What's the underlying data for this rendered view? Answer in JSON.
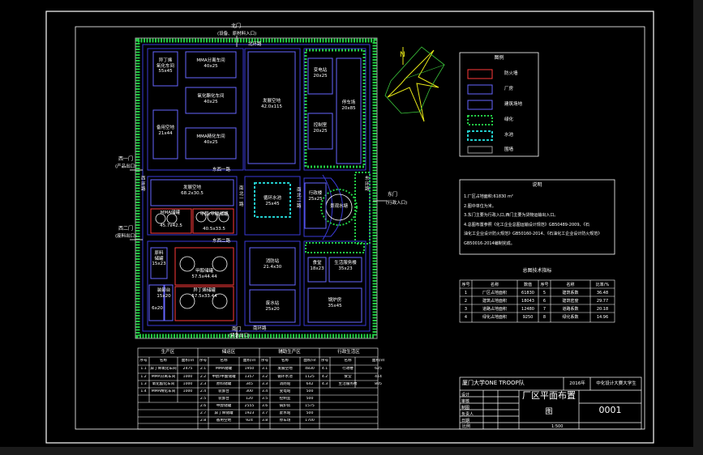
{
  "colors": {
    "background": "#000000",
    "frame": "#ffffff",
    "road": "#3a3ad8",
    "building": "#6666ff",
    "firewall": "#ff3a3a",
    "green": "#22cc44",
    "water": "#22cccc",
    "wall": "#9a9a9a",
    "compass": "#e6e617",
    "compass_web": "#3cc83c"
  },
  "gates": {
    "north": "北门",
    "north_sub": "(设备、原材料入口)",
    "west_gate1": "西一门",
    "west_gate1_sub": "(产品出口)",
    "west_gate2": "西二门",
    "west_gate2_sub": "(废料出口)",
    "east": "东门",
    "east_sub": "(行政入口)",
    "south": "南门",
    "south_sub": "(紧急出口)"
  },
  "roads": {
    "north": "北环路",
    "east1": "东环路",
    "south": "南环路",
    "west1": "西环路",
    "east_row1": "东西一路",
    "east_row2": "东西二路",
    "ns1": "南北一路",
    "ns2": "南北二路"
  },
  "buildings": {
    "b1": [
      "异丁烯",
      "氧化车间",
      "55x45"
    ],
    "b2": [
      "MMA分离车间",
      "40x25"
    ],
    "b3": [
      "氧化酯化车间",
      "40x25"
    ],
    "b4": [
      "MMA精化车间",
      "40x25"
    ],
    "b5": [
      "备用空地",
      "21x44"
    ],
    "b6": [
      "发展空地",
      "42.0x115"
    ],
    "b7": [
      "变电站",
      "20x25"
    ],
    "b8": [
      "停车场",
      "20x85"
    ],
    "b9": [
      "控制室",
      "20x25"
    ],
    "b10": [
      "发展空地",
      "68.2x30.5"
    ],
    "b11": [
      "MMA储罐",
      "45.7x42.5"
    ],
    "b12": [
      "甲醇/甲酸储罐",
      "40.5x33.5"
    ],
    "b13": [
      "循环水池",
      "25x45"
    ],
    "b14": [
      "行政楼",
      "25x25"
    ],
    "b15": [
      "景观水塘"
    ],
    "b16": [
      "原料",
      "储罐",
      "15x23"
    ],
    "b17": [
      "甲醇储罐",
      "57.5x44.44"
    ],
    "b18": [
      "异丁烯储罐",
      "57.5x33.44"
    ],
    "b19": [
      "装卸台",
      "15x20"
    ],
    "b20": [
      "装卸台",
      "6x20"
    ],
    "b21": [
      "消防站",
      "21.4x30"
    ],
    "b22": [
      "食堂",
      "18x23"
    ],
    "b23": [
      "生活服务楼",
      "35x23"
    ],
    "b24": [
      "废水站",
      "25x20"
    ],
    "b25": [
      "锅炉房",
      "35x45"
    ]
  },
  "legend": {
    "title": "图例",
    "items": [
      "防火墙",
      "厂房",
      "建筑场地",
      "绿化",
      "水池",
      "围墙"
    ]
  },
  "notes": {
    "title": "说明",
    "lines": [
      "1.厂区占地面积:61830 m²",
      "2.图中单位为米。",
      "3.东门主要为行政入口,西门主要为货物运输出入口。",
      "4.总图布置参照《化工企业总图运输设计规范》GB50489-2009、《石",
      "油化工企业设计防火规范》GB50160-2014、《石油化工企业设计防火规范》",
      "GB50016-2014编制完成。"
    ]
  },
  "tech_index": {
    "title": "总图技术指标",
    "headers": [
      "序号",
      "名称",
      "数值",
      "序号",
      "名称",
      "比率/%"
    ],
    "rows": [
      [
        "1",
        "厂区占地面积",
        "61830",
        "5",
        "建筑系数",
        "36.48"
      ],
      [
        "2",
        "建筑占地面积",
        "18043",
        "6",
        "建筑密度",
        "29.77"
      ],
      [
        "3",
        "道路占地面积",
        "12480",
        "7",
        "道路系数",
        "20.18"
      ],
      [
        "4",
        "绿化占地面积",
        "9250",
        "8",
        "绿化系数",
        "14.96"
      ]
    ]
  },
  "title_block": {
    "school": "厦门大学ONE TROOP队",
    "year": "2016年",
    "competition": "中化设计大赛大学生",
    "drawing_title": "厂区平面布置",
    "drawing_title2": "图",
    "drawing_no": "0001",
    "scale": "1:500",
    "labels": [
      "设计",
      "审核",
      "制图",
      "负责人",
      "日期",
      "比例"
    ]
  },
  "schedule": {
    "g1_title": "生产区",
    "g2_title": "储运区",
    "g3_title": "辅助生产区",
    "g4_title": "行政生活区",
    "headers": [
      "序号",
      "名称",
      "面积/㎡"
    ],
    "g1_rows": [
      [
        "1.1",
        "异丁烯氧化车间",
        "2475"
      ],
      [
        "1.2",
        "MMA分离车间",
        "1000"
      ],
      [
        "1.3",
        "氧化酯化车间",
        "1000"
      ],
      [
        "1.4",
        "MMA精化车间",
        "1000"
      ]
    ],
    "g2_rows": [
      [
        "2.1",
        "MMA储罐",
        "1950"
      ],
      [
        "2.2",
        "甲醇/甲酸储罐",
        "1357"
      ],
      [
        "2.3",
        "原料储罐",
        "345"
      ],
      [
        "2.4",
        "装卸台",
        "300"
      ],
      [
        "2.5",
        "装卸台",
        "120"
      ],
      [
        "2.6",
        "甲醇储罐",
        "2555"
      ],
      [
        "2.7",
        "异丁烯储罐",
        "1923"
      ],
      [
        "2.8",
        "备用空地",
        "924"
      ]
    ],
    "g3_rows": [
      [
        "3.1",
        "发展空地",
        "4830"
      ],
      [
        "3.2",
        "循环水池",
        "1125"
      ],
      [
        "3.3",
        "消防站",
        "642"
      ],
      [
        "3.4",
        "变电站",
        "500"
      ],
      [
        "3.5",
        "控制室",
        "500"
      ],
      [
        "3.6",
        "锅炉房",
        "1575"
      ],
      [
        "3.7",
        "废水站",
        "500"
      ],
      [
        "3.8",
        "停车场",
        "1700"
      ]
    ],
    "g4_rows": [
      [
        "4.1",
        "行政楼",
        "625"
      ],
      [
        "4.2",
        "食堂",
        "414"
      ],
      [
        "4.3",
        "生活服务楼",
        "805"
      ]
    ]
  }
}
